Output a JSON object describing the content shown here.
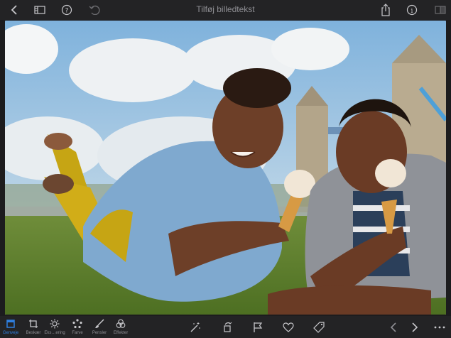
{
  "window": {
    "title": "Tilføj billedtekst"
  },
  "topbar": {
    "back_icon": "chevron-left-icon",
    "browser_icon": "film-strip-icon",
    "help_icon": "question-circle-icon",
    "undo_icon": "undo-icon",
    "share_icon": "share-icon",
    "info_icon": "info-circle-icon",
    "compare_icon": "compare-icon"
  },
  "tools": [
    {
      "label": "Genveje",
      "icon": "crop-square-icon",
      "active": true
    },
    {
      "label": "Beskær",
      "icon": "crop-icon"
    },
    {
      "label": "Eks…ering",
      "icon": "sun-icon"
    },
    {
      "label": "Farve",
      "icon": "palette-icon"
    },
    {
      "label": "Pensler",
      "icon": "brush-icon"
    },
    {
      "label": "Effekter",
      "icon": "effects-circles-icon"
    }
  ],
  "actions": {
    "magic_icon": "magic-wand-icon",
    "rotate_icon": "rotate-icon",
    "flag_icon": "flag-icon",
    "heart_icon": "heart-icon",
    "tag_icon": "tag-icon",
    "prev_icon": "chevron-left-icon",
    "next_icon": "chevron-right-icon",
    "more_icon": "more-icon"
  },
  "colors": {
    "accent": "#2f7fe0",
    "bar": "#232325",
    "icon": "#c8c8cc"
  }
}
